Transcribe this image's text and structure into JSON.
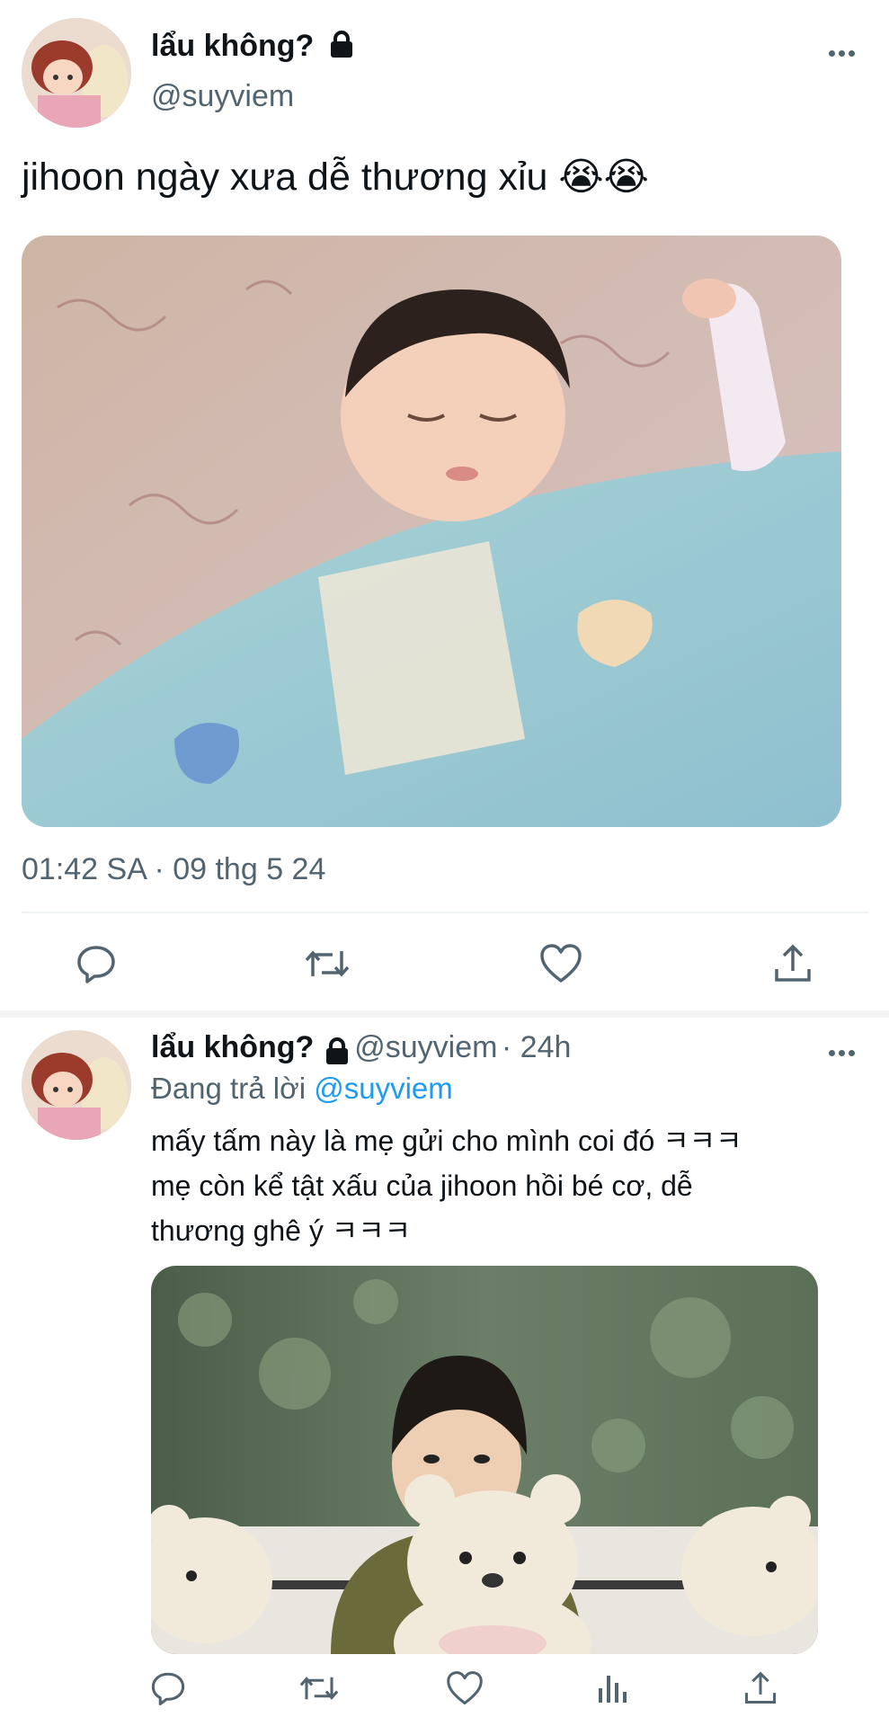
{
  "tweet": {
    "display_name": "lẩu không?",
    "handle": "@suyviem",
    "text": "jihoon ngày xưa dễ thương xỉu 😭😭",
    "timestamp": "01:42 SA · 09 thg 5 24",
    "actions": [
      "reply-icon",
      "retweet-icon",
      "like-icon",
      "share-icon"
    ]
  },
  "reply": {
    "display_name": "lẩu không?",
    "handle": "@suyviem",
    "time": "· 24h",
    "replying_prefix": "Đang trả lời",
    "replying_to": "@suyviem",
    "text_line1": "mấy tấm này là mẹ gửi cho mình coi đó ㅋㅋㅋ",
    "text_line2": "mẹ còn kể tật xấu của jihoon hồi bé cơ, dễ",
    "text_line3": "thương ghê ý ㅋㅋㅋ",
    "actions": [
      "reply-icon",
      "retweet-icon",
      "like-icon",
      "views-icon",
      "share-icon"
    ]
  },
  "colors": {
    "text": "#0f1419",
    "secondary": "#536471",
    "link": "#1d9bf0",
    "divider": "#eff3f4"
  }
}
